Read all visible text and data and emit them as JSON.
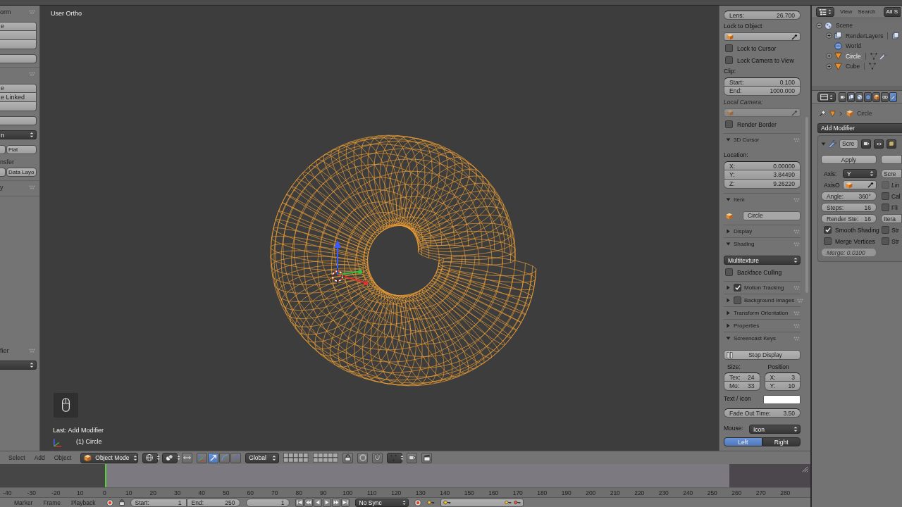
{
  "tool_shelf": {
    "panels": [
      {
        "title": "orm",
        "blocks": [
          [
            {
              "kind": "button",
              "label": "e"
            },
            {
              "kind": "button"
            },
            {
              "kind": "button"
            }
          ],
          [
            {
              "kind": "button"
            }
          ]
        ]
      },
      {
        "blocks": [
          [
            {
              "kind": "button",
              "label": "e"
            },
            {
              "kind": "button",
              "label": "e Linked"
            },
            {
              "kind": "button"
            }
          ],
          [
            {
              "kind": "button"
            }
          ],
          [
            {
              "kind": "dropdown",
              "label": "n"
            }
          ],
          [
            {
              "kind": "pair",
              "label": "Flat"
            }
          ],
          [
            {
              "kind": "text",
              "label": "nsfer"
            }
          ],
          [
            {
              "kind": "pair",
              "label": "Data Layo"
            }
          ]
        ]
      },
      {
        "title": "y"
      }
    ]
  },
  "operator_panel": {
    "title": "fier",
    "blocks": [
      [
        {
          "kind": "dropdown"
        }
      ]
    ]
  },
  "viewport": {
    "view_name": "User Ortho",
    "last_operator": "Last: Add Modifier",
    "object_info": "(1) Circle"
  },
  "sidebar": {
    "panels": [
      {
        "rows": [
          {
            "kind": "fields",
            "items": [
              {
                "label": "Lens:",
                "value": "26.700"
              }
            ]
          },
          {
            "kind": "label",
            "text": "Lock to Object",
            "disabled": false
          },
          {
            "kind": "object",
            "disabled": false
          },
          {
            "kind": "checkbox",
            "label": "Lock to Cursor",
            "checked": false
          },
          {
            "kind": "checkbox",
            "label": "Lock Camera to View",
            "checked": false
          },
          {
            "kind": "label",
            "text": "Clip:",
            "disabled": false
          },
          {
            "kind": "fields",
            "items": [
              {
                "label": "Start:",
                "value": "0.100"
              },
              {
                "label": "End:",
                "value": "1000.000"
              }
            ]
          },
          {
            "kind": "label",
            "text": "Local Camera:",
            "disabled": true
          },
          {
            "kind": "object",
            "disabled": true
          },
          {
            "kind": "checkbox",
            "label": "Render Border",
            "checked": false
          }
        ]
      },
      {
        "title": "3D Cursor",
        "expanded": true,
        "rows": [
          {
            "kind": "label",
            "text": "Location:",
            "disabled": false
          },
          {
            "kind": "fields",
            "items": [
              {
                "label": "X:",
                "value": "0.00000"
              },
              {
                "label": "Y:",
                "value": "3.84490"
              },
              {
                "label": "Z:",
                "value": "9.26220"
              }
            ]
          }
        ]
      },
      {
        "title": "Item",
        "expanded": true,
        "rows": [
          {
            "kind": "name",
            "value": "Circle"
          }
        ]
      },
      {
        "title": "Display",
        "expanded": false
      },
      {
        "title": "Shading",
        "expanded": true,
        "rows": [
          {
            "kind": "dropdown",
            "value": "Multitexture"
          },
          {
            "kind": "checkbox",
            "label": "Backface Culling",
            "checked": false
          }
        ]
      },
      {
        "title": "Motion Tracking",
        "expanded": false,
        "toggle": {
          "checked": true
        }
      },
      {
        "title": "Background Images",
        "expanded": false,
        "toggle": {
          "checked": false
        }
      },
      {
        "title": "Transform Orientation",
        "expanded": false
      },
      {
        "title": "Properties",
        "expanded": false
      },
      {
        "title": "Screencast Keys",
        "expanded": true,
        "rows": [
          {
            "kind": "button",
            "label": "Stop Display"
          },
          {
            "kind": "columns",
            "columns": [
              {
                "title": "Size:",
                "items": [
                  {
                    "label": "Tex:",
                    "value": "24"
                  },
                  {
                    "label": "Mo:",
                    "value": "33"
                  }
                ]
              },
              {
                "title": "Position",
                "items": [
                  {
                    "label": "X:",
                    "value": "3"
                  },
                  {
                    "label": "Y:",
                    "value": "10"
                  }
                ]
              }
            ]
          },
          {
            "kind": "color",
            "label": "Text / Icon",
            "color": "#ffffff"
          },
          {
            "kind": "fields",
            "items": [
              {
                "label": "Fade Out Time:",
                "value": "3.50"
              }
            ]
          },
          {
            "kind": "dropdown",
            "label": "Mouse:",
            "value": "Icon"
          },
          {
            "kind": "segmented",
            "options": [
              {
                "label": "Left",
                "selected": true
              },
              {
                "label": "Right",
                "selected": false
              }
            ]
          }
        ]
      }
    ]
  },
  "outliner": {
    "menus": [
      "View",
      "Search"
    ],
    "filter": "All S",
    "tree": [
      {
        "kind": "scene",
        "label": "Scene",
        "expanded": true,
        "selected": false,
        "children": [
          {
            "kind": "render_layers",
            "label": "RenderLayers",
            "expanded": false,
            "selected": false
          },
          {
            "kind": "world",
            "label": "World",
            "selected": false
          },
          {
            "kind": "mesh",
            "label": "Circle",
            "expanded": false,
            "selected": true,
            "modifier": true
          },
          {
            "kind": "mesh",
            "label": "Cube",
            "expanded": false,
            "selected": false,
            "modifier": false
          }
        ]
      }
    ]
  },
  "properties": {
    "tabs": [
      {
        "kind": "render",
        "selected": false
      },
      {
        "kind": "layers",
        "selected": false
      },
      {
        "kind": "scene",
        "selected": false
      },
      {
        "kind": "world",
        "selected": false
      },
      {
        "kind": "object",
        "selected": false
      },
      {
        "kind": "constraints",
        "selected": false
      },
      {
        "kind": "modifiers",
        "selected": true
      }
    ],
    "context": "Circle",
    "add_modifier": "Add Modifier",
    "modifier": {
      "name": "Scre",
      "expanded": true,
      "rows": [
        {
          "left": {
            "kind": "button",
            "label": "Apply"
          },
          "right": {
            "kind": "button"
          }
        },
        {
          "left": {
            "kind": "dropdown",
            "label": "Axis:",
            "value": "Y"
          },
          "right": {
            "kind": "field",
            "label": "Scre",
            "disabled": false
          }
        },
        {
          "left": {
            "kind": "object",
            "label": "AxisO"
          },
          "right": {
            "kind": "checkbox",
            "label": "Lin",
            "checked": false,
            "disabled": true
          }
        },
        {
          "left": {
            "kind": "field",
            "label": "Angle:",
            "value": "360°",
            "disabled": false
          },
          "right": {
            "kind": "checkbox",
            "label": "Cal",
            "checked": false,
            "disabled": false
          }
        },
        {
          "left": {
            "kind": "field",
            "label": "Steps:",
            "value": "16",
            "disabled": false
          },
          "right": {
            "kind": "checkbox",
            "label": "Fli",
            "checked": false,
            "disabled": false
          }
        },
        {
          "left": {
            "kind": "field",
            "label": "Render Ste:",
            "value": "16",
            "disabled": false
          },
          "right": {
            "kind": "field",
            "label": "Itera",
            "disabled": false
          }
        },
        {
          "left": {
            "kind": "checkbox",
            "label": "Smooth Shading",
            "checked": true,
            "disabled": false
          },
          "right": {
            "kind": "checkbox",
            "label": "Str",
            "checked": false,
            "disabled": false
          }
        },
        {
          "left": {
            "kind": "checkbox",
            "label": "Merge Vertices",
            "checked": false,
            "disabled": false
          },
          "right": {
            "kind": "checkbox",
            "label": "Str",
            "checked": false,
            "disabled": false
          }
        },
        {
          "left": {
            "kind": "field",
            "label": "Merge: 0.0100",
            "disabled": true
          }
        }
      ]
    }
  },
  "view_header": {
    "menus": [
      "Select",
      "Add",
      "Object"
    ],
    "mode": "Object Mode",
    "manipulators": [
      {
        "kind": "translate",
        "selected": true
      },
      {
        "kind": "rotate",
        "selected": false
      },
      {
        "kind": "scale",
        "selected": false
      }
    ],
    "orientation": "Global"
  },
  "timeline": {
    "ruler": [
      "-40",
      "-30",
      "-20",
      "10",
      "0",
      "10",
      "20",
      "30",
      "40",
      "50",
      "60",
      "70",
      "80",
      "90",
      "100",
      "110",
      "120",
      "130",
      "140",
      "150",
      "160",
      "170",
      "180",
      "190",
      "200",
      "210",
      "220",
      "230",
      "240",
      "250",
      "260",
      "270",
      "280"
    ]
  },
  "timeline_header": {
    "menus": [
      "Marker",
      "Frame",
      "Playback"
    ],
    "range": [
      {
        "label": "Start:",
        "value": "1"
      },
      {
        "label": "End:",
        "value": "250"
      }
    ],
    "current_frame": "1",
    "sync": "No Sync"
  }
}
